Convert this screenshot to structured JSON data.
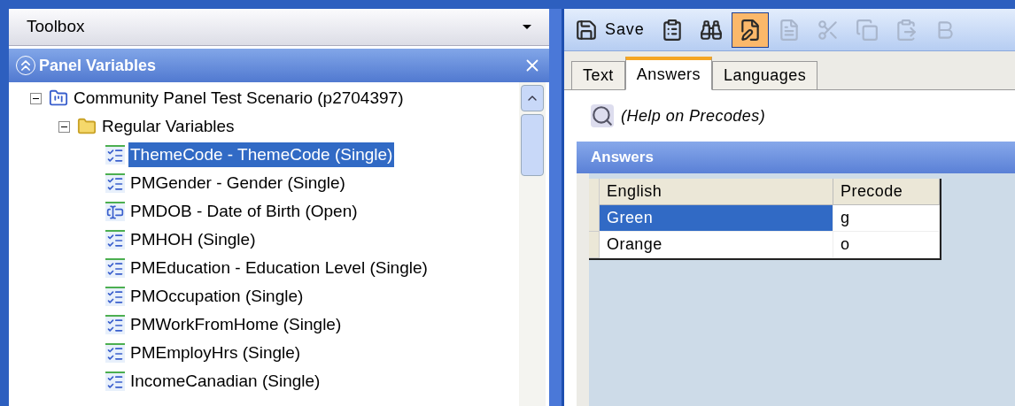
{
  "toolbox": {
    "title": "Toolbox"
  },
  "panel": {
    "title": "Panel Variables"
  },
  "tree": [
    {
      "label": "Community Panel Test Scenario (p2704397)",
      "kind": "project",
      "expanded": true,
      "selected": false,
      "children": [
        {
          "label": "Regular Variables",
          "kind": "folder",
          "expanded": true,
          "selected": false,
          "children": [
            {
              "label": "ThemeCode - ThemeCode (Single)",
              "kind": "single",
              "selected": true
            },
            {
              "label": "PMGender - Gender (Single)",
              "kind": "single",
              "selected": false
            },
            {
              "label": "PMDOB - Date of Birth (Open)",
              "kind": "open",
              "selected": false
            },
            {
              "label": "PMHOH (Single)",
              "kind": "single",
              "selected": false
            },
            {
              "label": "PMEducation - Education Level (Single)",
              "kind": "single",
              "selected": false
            },
            {
              "label": "PMOccupation (Single)",
              "kind": "single",
              "selected": false
            },
            {
              "label": "PMWorkFromHome (Single)",
              "kind": "single",
              "selected": false
            },
            {
              "label": "PMEmployHrs (Single)",
              "kind": "single",
              "selected": false
            },
            {
              "label": "IncomeCanadian (Single)",
              "kind": "single",
              "selected": false
            }
          ]
        }
      ]
    }
  ],
  "toolbar": [
    {
      "kind": "save",
      "label": "Save",
      "disabled": false,
      "active": false
    },
    {
      "kind": "properties",
      "disabled": false,
      "active": false
    },
    {
      "kind": "find",
      "disabled": false,
      "active": false
    },
    {
      "kind": "edit",
      "disabled": false,
      "active": true
    },
    {
      "kind": "page",
      "disabled": true,
      "active": false
    },
    {
      "kind": "cut",
      "disabled": true,
      "active": false
    },
    {
      "kind": "copy",
      "disabled": true,
      "active": false
    },
    {
      "kind": "paste",
      "disabled": true,
      "active": false
    },
    {
      "kind": "bold",
      "disabled": true,
      "active": false
    }
  ],
  "tabs": [
    {
      "label": "Text",
      "selected": false
    },
    {
      "label": "Answers",
      "selected": true
    },
    {
      "label": "Languages",
      "selected": false
    }
  ],
  "help_link": "(Help on Precodes)",
  "answers": {
    "title": "Answers",
    "columns": [
      "English",
      "Precode"
    ],
    "rows": [
      {
        "cells": [
          "Green",
          "g"
        ],
        "selected": true
      },
      {
        "cells": [
          "Orange",
          "o"
        ],
        "selected": false
      }
    ]
  }
}
